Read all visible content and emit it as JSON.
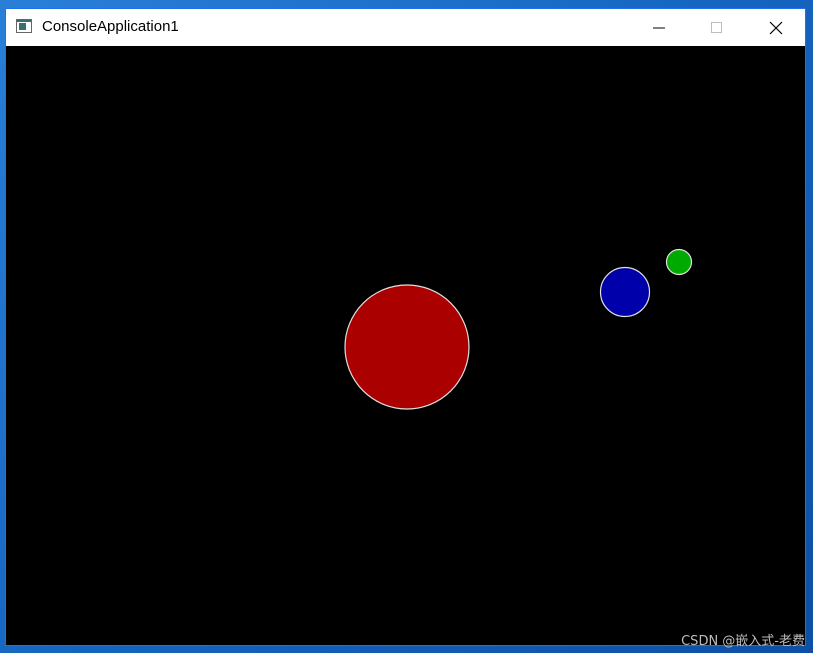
{
  "window": {
    "title": "ConsoleApplication1",
    "app_icon": "console-window-icon",
    "controls": {
      "minimize_icon": "minimize-icon",
      "maximize_icon": "maximize-icon",
      "close_icon": "close-icon"
    }
  },
  "canvas": {
    "background_color": "#000000",
    "circles": [
      {
        "name": "red-circle",
        "fill": "#aa0000",
        "stroke": "#e0e0e0"
      },
      {
        "name": "blue-circle",
        "fill": "#0000aa",
        "stroke": "#e0e0e0"
      },
      {
        "name": "green-circle",
        "fill": "#00aa00",
        "stroke": "#e0e0e0"
      }
    ]
  },
  "watermark": {
    "text": "CSDN @嵌入式-老费"
  }
}
